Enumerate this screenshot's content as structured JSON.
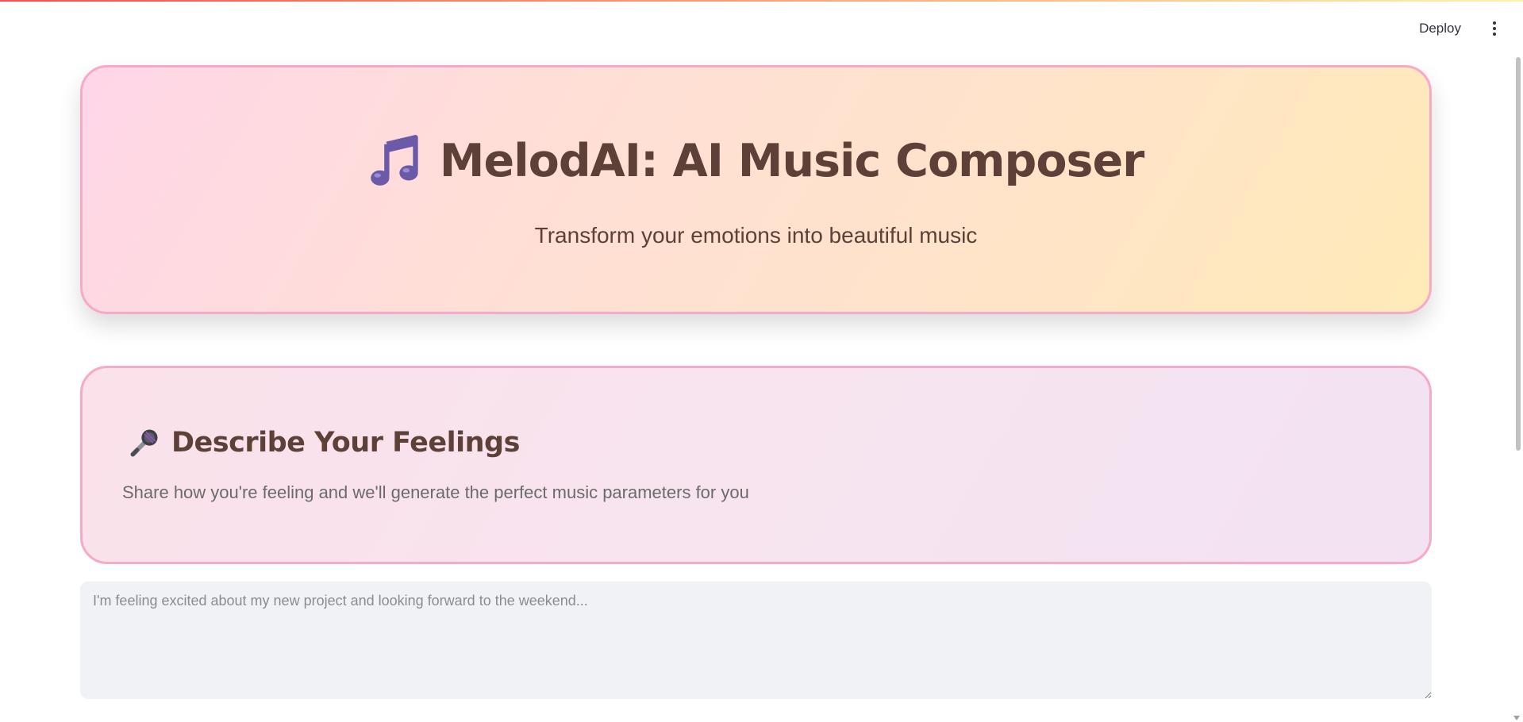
{
  "app": {
    "title": "MelodAI: AI Music Composer",
    "subtitle": "Transform your emotions into beautiful music"
  },
  "toolbar": {
    "deploy_label": "Deploy",
    "menu_icon": "vertical-dots-icon"
  },
  "feelings": {
    "heading": "Describe Your Feelings",
    "description": "Share how you're feeling and we'll generate the perfect music parameters for you",
    "heading_icon": "microphone-icon",
    "input_value": "",
    "input_placeholder": "I'm feeling excited about my new project and looking forward to the weekend..."
  },
  "icons": {
    "title_icon": "music-note-icon"
  },
  "colors": {
    "title_text": "#5d4037",
    "card_border": "#f6a9c8",
    "note_icon": "#6b5aa8",
    "input_bg": "#f0f2f6"
  }
}
